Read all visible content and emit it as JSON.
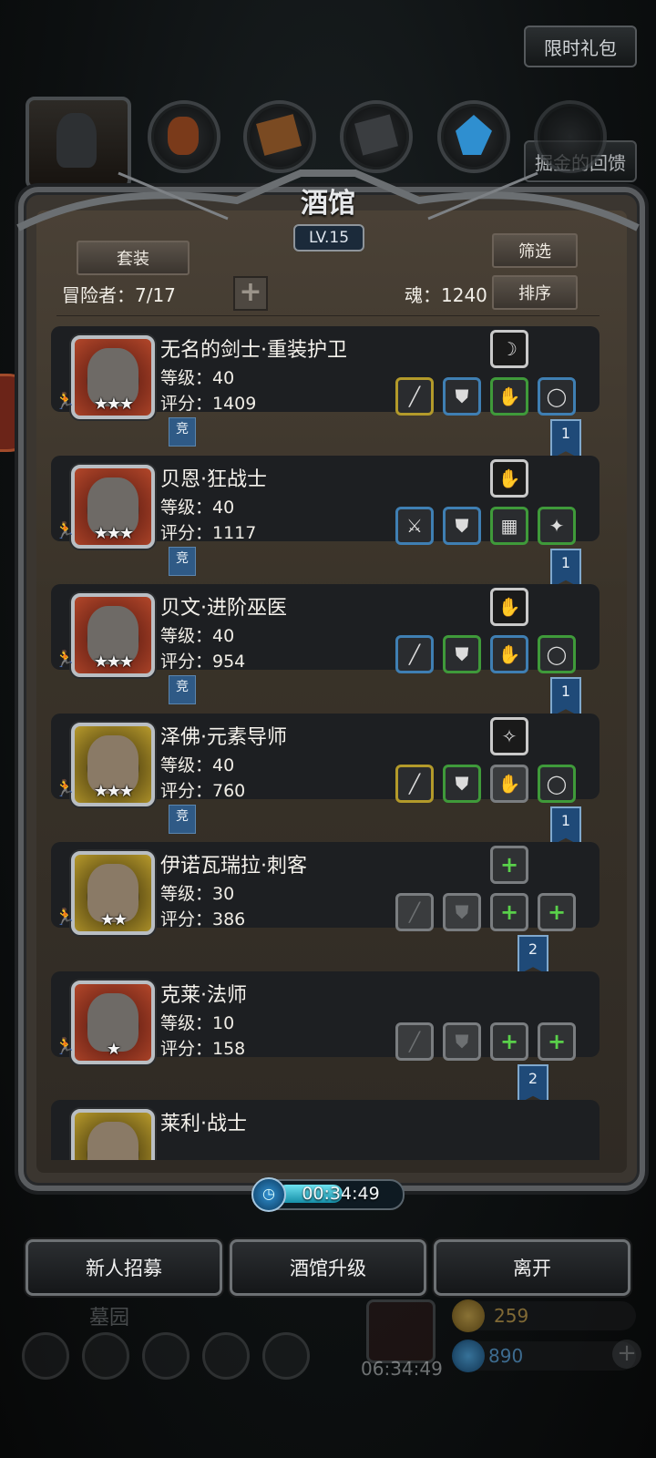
{
  "top_buttons": {
    "limited_gift": "限时礼包",
    "gold_feedback": "掘金的回馈"
  },
  "panel": {
    "title": "酒馆",
    "level": "LV.15",
    "set_button": "套装",
    "filter_button": "筛选",
    "sort_button": "排序",
    "adventurers": "冒险者：7/17",
    "soul": "魂：1240",
    "add_icon": "plus-icon"
  },
  "heroes": [
    {
      "name": "无名的剑士·重装护卫",
      "level": "等级：40",
      "score": "评分：1409",
      "stars": "★★★",
      "frame": "red",
      "badge": "竞",
      "ribbon": "1",
      "top_slot": {
        "icon": "claw-icon",
        "glyph": "☽"
      },
      "slots": [
        {
          "icon": "spear-icon",
          "glyph": "╱",
          "color": "yellow"
        },
        {
          "icon": "armor-icon",
          "glyph": "⛊",
          "color": "blue"
        },
        {
          "icon": "gauntlet-icon",
          "glyph": "✋",
          "color": "green"
        },
        {
          "icon": "ring-icon",
          "glyph": "◯",
          "color": "blue"
        }
      ]
    },
    {
      "name": "贝恩·狂战士",
      "level": "等级：40",
      "score": "评分：1117",
      "stars": "★★★",
      "frame": "red",
      "badge": "竞",
      "ribbon": "1",
      "top_slot": {
        "icon": "gauntlet-icon",
        "glyph": "✋"
      },
      "slots": [
        {
          "icon": "axe-icon",
          "glyph": "⚔",
          "color": "blue"
        },
        {
          "icon": "armor-icon",
          "glyph": "⛊",
          "color": "blue"
        },
        {
          "icon": "chest-armor-icon",
          "glyph": "▦",
          "color": "green"
        },
        {
          "icon": "amulet-icon",
          "glyph": "✦",
          "color": "green"
        }
      ]
    },
    {
      "name": "贝文·进阶巫医",
      "level": "等级：40",
      "score": "评分：954",
      "stars": "★★★",
      "frame": "red",
      "badge": "竞",
      "ribbon": "1",
      "top_slot": {
        "icon": "gauntlet-icon",
        "glyph": "✋"
      },
      "slots": [
        {
          "icon": "staff-icon",
          "glyph": "╱",
          "color": "blue"
        },
        {
          "icon": "armor-icon",
          "glyph": "⛊",
          "color": "green"
        },
        {
          "icon": "gauntlet-icon",
          "glyph": "✋",
          "color": "blue"
        },
        {
          "icon": "ring-icon",
          "glyph": "◯",
          "color": "green"
        }
      ]
    },
    {
      "name": "泽佛·元素导师",
      "level": "等级：40",
      "score": "评分：760",
      "stars": "★★★",
      "frame": "gold",
      "badge": "竞",
      "ribbon": "1",
      "top_slot": {
        "icon": "crystal-icon",
        "glyph": "✧"
      },
      "slots": [
        {
          "icon": "staff-icon",
          "glyph": "╱",
          "color": "yellow"
        },
        {
          "icon": "armor-icon",
          "glyph": "⛊",
          "color": "green"
        },
        {
          "icon": "gauntlet-icon",
          "glyph": "✋",
          "color": "gray"
        },
        {
          "icon": "ring-icon",
          "glyph": "◯",
          "color": "green"
        }
      ]
    },
    {
      "name": "伊诺瓦瑞拉·刺客",
      "level": "等级：30",
      "score": "评分：386",
      "stars": "★★",
      "frame": "gold",
      "badge": "",
      "ribbon": "2",
      "top_slot": {
        "icon": "add-icon",
        "glyph": "+"
      },
      "slots": [
        {
          "icon": "blade-placeholder-icon",
          "glyph": "╱",
          "color": "gray"
        },
        {
          "icon": "armor-placeholder-icon",
          "glyph": "⛊",
          "color": "gray"
        },
        {
          "icon": "add-icon",
          "glyph": "+",
          "color": "add"
        },
        {
          "icon": "add-icon",
          "glyph": "+",
          "color": "add"
        }
      ]
    },
    {
      "name": "克莱·法师",
      "level": "等级：10",
      "score": "评分：158",
      "stars": "★",
      "frame": "red",
      "badge": "",
      "ribbon": "2",
      "top_slot": null,
      "slots": [
        {
          "icon": "staff-placeholder-icon",
          "glyph": "╱",
          "color": "gray"
        },
        {
          "icon": "armor-placeholder-icon",
          "glyph": "⛊",
          "color": "gray"
        },
        {
          "icon": "add-icon",
          "glyph": "+",
          "color": "add"
        },
        {
          "icon": "add-icon",
          "glyph": "+",
          "color": "add"
        }
      ]
    },
    {
      "name": "莱利·战士",
      "level": "",
      "score": "",
      "stars": "",
      "frame": "gold",
      "badge": "",
      "ribbon": "",
      "top_slot": null,
      "slots": []
    }
  ],
  "timer": "00:34:49",
  "timer_progress": 0.55,
  "bottom_buttons": {
    "recruit": "新人招募",
    "upgrade": "酒馆升级",
    "leave": "离开"
  },
  "background_hud": {
    "area_name": "墓园",
    "gift_timer": "06:34:49",
    "gold": "259",
    "gems": "890"
  },
  "colors": {
    "slot_yellow": "#b39a2a",
    "slot_blue": "#3f7fb3",
    "slot_green": "#3f9a3a",
    "ribbon_blue": "#1f4a78",
    "timer_cyan": "#6ee2f0"
  }
}
